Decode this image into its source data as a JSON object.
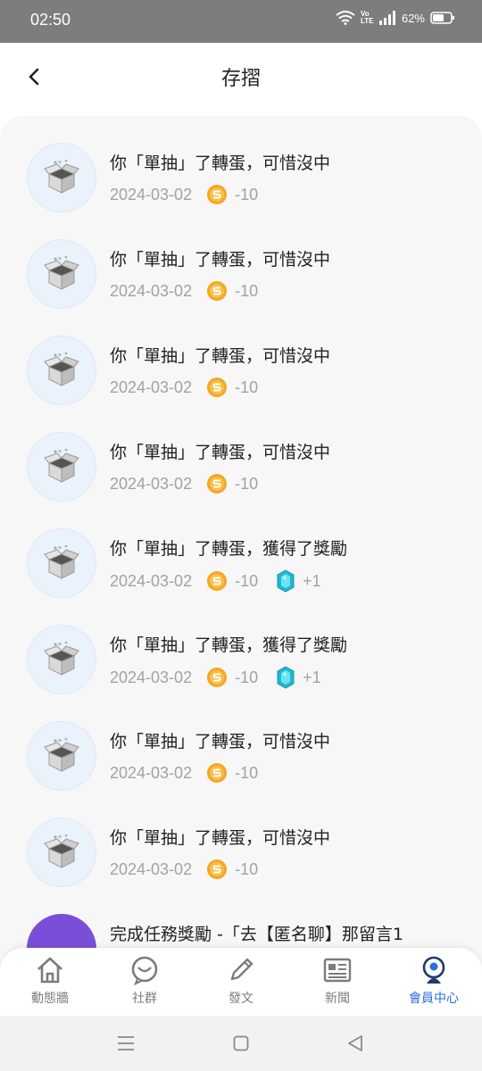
{
  "status_bar": {
    "time": "02:50",
    "battery_percent": "62%",
    "volte": "Vo LTE"
  },
  "header": {
    "title": "存摺"
  },
  "records": [
    {
      "title": "你「單抽」了轉蛋，可惜沒中",
      "date": "2024-03-02",
      "coin": "-10",
      "gem": null
    },
    {
      "title": "你「單抽」了轉蛋，可惜沒中",
      "date": "2024-03-02",
      "coin": "-10",
      "gem": null
    },
    {
      "title": "你「單抽」了轉蛋，可惜沒中",
      "date": "2024-03-02",
      "coin": "-10",
      "gem": null
    },
    {
      "title": "你「單抽」了轉蛋，可惜沒中",
      "date": "2024-03-02",
      "coin": "-10",
      "gem": null
    },
    {
      "title": "你「單抽」了轉蛋，獲得了獎勵",
      "date": "2024-03-02",
      "coin": "-10",
      "gem": "+1"
    },
    {
      "title": "你「單抽」了轉蛋，獲得了獎勵",
      "date": "2024-03-02",
      "coin": "-10",
      "gem": "+1"
    },
    {
      "title": "你「單抽」了轉蛋，可惜沒中",
      "date": "2024-03-02",
      "coin": "-10",
      "gem": null
    },
    {
      "title": "你「單抽」了轉蛋，可惜沒中",
      "date": "2024-03-02",
      "coin": "-10",
      "gem": null
    }
  ],
  "partial_record": {
    "title": "完成任務獎勵 -「去【匿名聊】那留言1"
  },
  "tabs": [
    {
      "label": "動態牆",
      "icon": "home-icon",
      "active": false
    },
    {
      "label": "社群",
      "icon": "chat-bubble-icon",
      "active": false
    },
    {
      "label": "發文",
      "icon": "pencil-icon",
      "active": false
    },
    {
      "label": "新聞",
      "icon": "newspaper-icon",
      "active": false
    },
    {
      "label": "會員中心",
      "icon": "member-icon",
      "active": true
    }
  ],
  "colors": {
    "accent": "#2a6fdb",
    "coin": "#f5a623",
    "gem": "#2ec4d6",
    "status_bar": "#7d7d7d"
  }
}
